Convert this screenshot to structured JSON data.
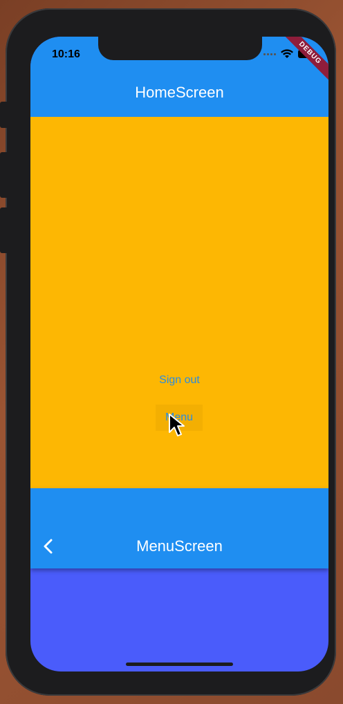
{
  "status_bar": {
    "time": "10:16",
    "debug_label": "DEBUG"
  },
  "home": {
    "title": "HomeScreen",
    "signout_label": "Sign out",
    "menu_label": "Menu",
    "colors": {
      "appbar": "#1f8ef1",
      "body": "#fdb703",
      "link": "#2a8de0"
    }
  },
  "menu": {
    "title": "MenuScreen",
    "icons": {
      "back": "chevron-left-icon"
    },
    "colors": {
      "appbar": "#1f8ef1",
      "body": "#4a5cfb"
    }
  }
}
